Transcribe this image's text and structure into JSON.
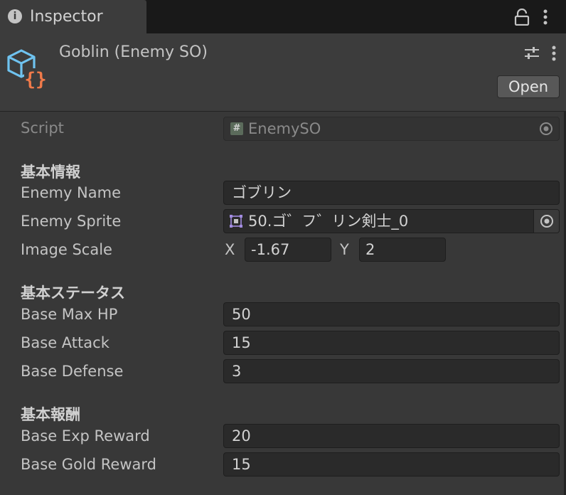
{
  "tab": {
    "title": "Inspector"
  },
  "header": {
    "asset_title": "Goblin (Enemy SO)",
    "open_label": "Open"
  },
  "script": {
    "label": "Script",
    "value": "EnemySO"
  },
  "sections": {
    "basic_info": "基本情報",
    "basic_status": "基本ステータス",
    "basic_reward": "基本報酬"
  },
  "fields": {
    "enemy_name": {
      "label": "Enemy Name",
      "value": "ゴブリン"
    },
    "enemy_sprite": {
      "label": "Enemy Sprite",
      "value": "50.ゴ゛フ゛リン剣士_0"
    },
    "image_scale": {
      "label": "Image Scale",
      "x_label": "X",
      "x": "-1.67",
      "y_label": "Y",
      "y": "2"
    },
    "base_max_hp": {
      "label": "Base Max HP",
      "value": "50"
    },
    "base_attack": {
      "label": "Base Attack",
      "value": "15"
    },
    "base_defense": {
      "label": "Base Defense",
      "value": "3"
    },
    "base_exp_reward": {
      "label": "Base Exp Reward",
      "value": "20"
    },
    "base_gold_reward": {
      "label": "Base Gold Reward",
      "value": "15"
    }
  },
  "colors": {
    "icon_blue": "#6fc3f0",
    "icon_orange": "#f07a4a",
    "sprite_purple": "#a28ce0"
  }
}
